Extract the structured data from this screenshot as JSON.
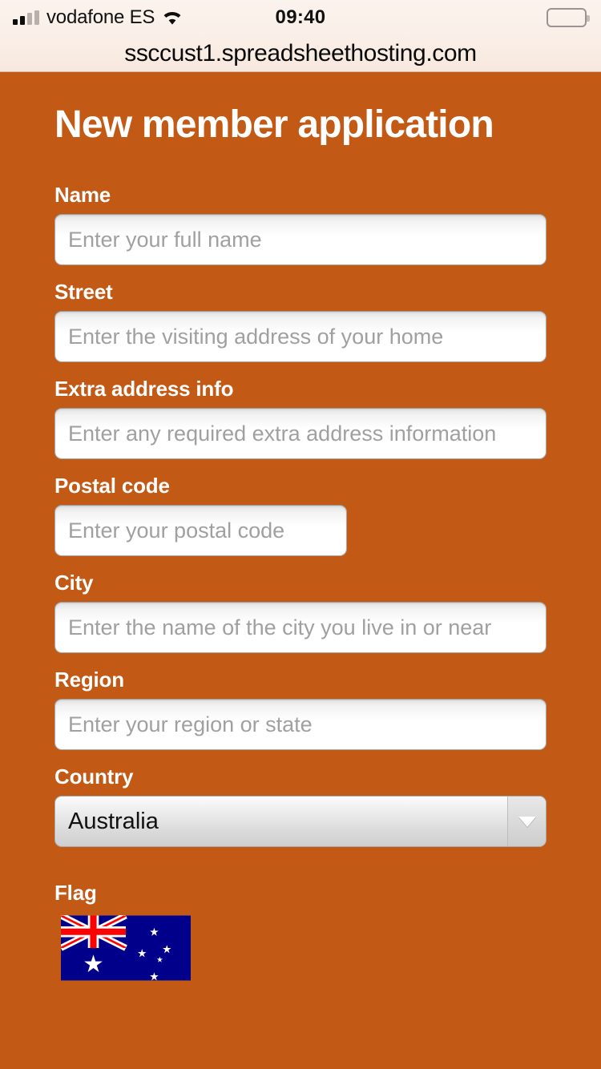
{
  "status_bar": {
    "carrier": "vodafone ES",
    "time": "09:40",
    "signal_icon": "signal-bars-icon",
    "wifi_icon": "wifi-icon",
    "battery_icon": "battery-full-icon"
  },
  "browser": {
    "url": "ssccust1.spreadsheethosting.com"
  },
  "page": {
    "title": "New member application",
    "background_color": "#c25915",
    "text_color": "#ffffff"
  },
  "form": {
    "fields": [
      {
        "id": "name",
        "label": "Name",
        "placeholder": "Enter your full name",
        "value": "",
        "type": "text",
        "width": "full"
      },
      {
        "id": "street",
        "label": "Street",
        "placeholder": "Enter the visiting address of your home",
        "value": "",
        "type": "text",
        "width": "full"
      },
      {
        "id": "extra_address_info",
        "label": "Extra address info",
        "placeholder": "Enter any required extra address information",
        "value": "",
        "type": "text",
        "width": "full"
      },
      {
        "id": "postal_code",
        "label": "Postal code",
        "placeholder": "Enter your postal code",
        "value": "",
        "type": "text",
        "width": "narrow"
      },
      {
        "id": "city",
        "label": "City",
        "placeholder": "Enter the name of the city you live in or near",
        "value": "",
        "type": "text",
        "width": "full"
      },
      {
        "id": "region",
        "label": "Region",
        "placeholder": "Enter your region or state",
        "value": "",
        "type": "text",
        "width": "full"
      }
    ],
    "country": {
      "label": "Country",
      "selected": "Australia",
      "dropdown_icon": "chevron-down-icon"
    },
    "flag": {
      "label": "Flag",
      "country_name": "Australia",
      "icon": "australia-flag-icon",
      "colors": {
        "field": "#00008b",
        "cross": "#ff0000",
        "star": "#ffffff"
      }
    }
  }
}
